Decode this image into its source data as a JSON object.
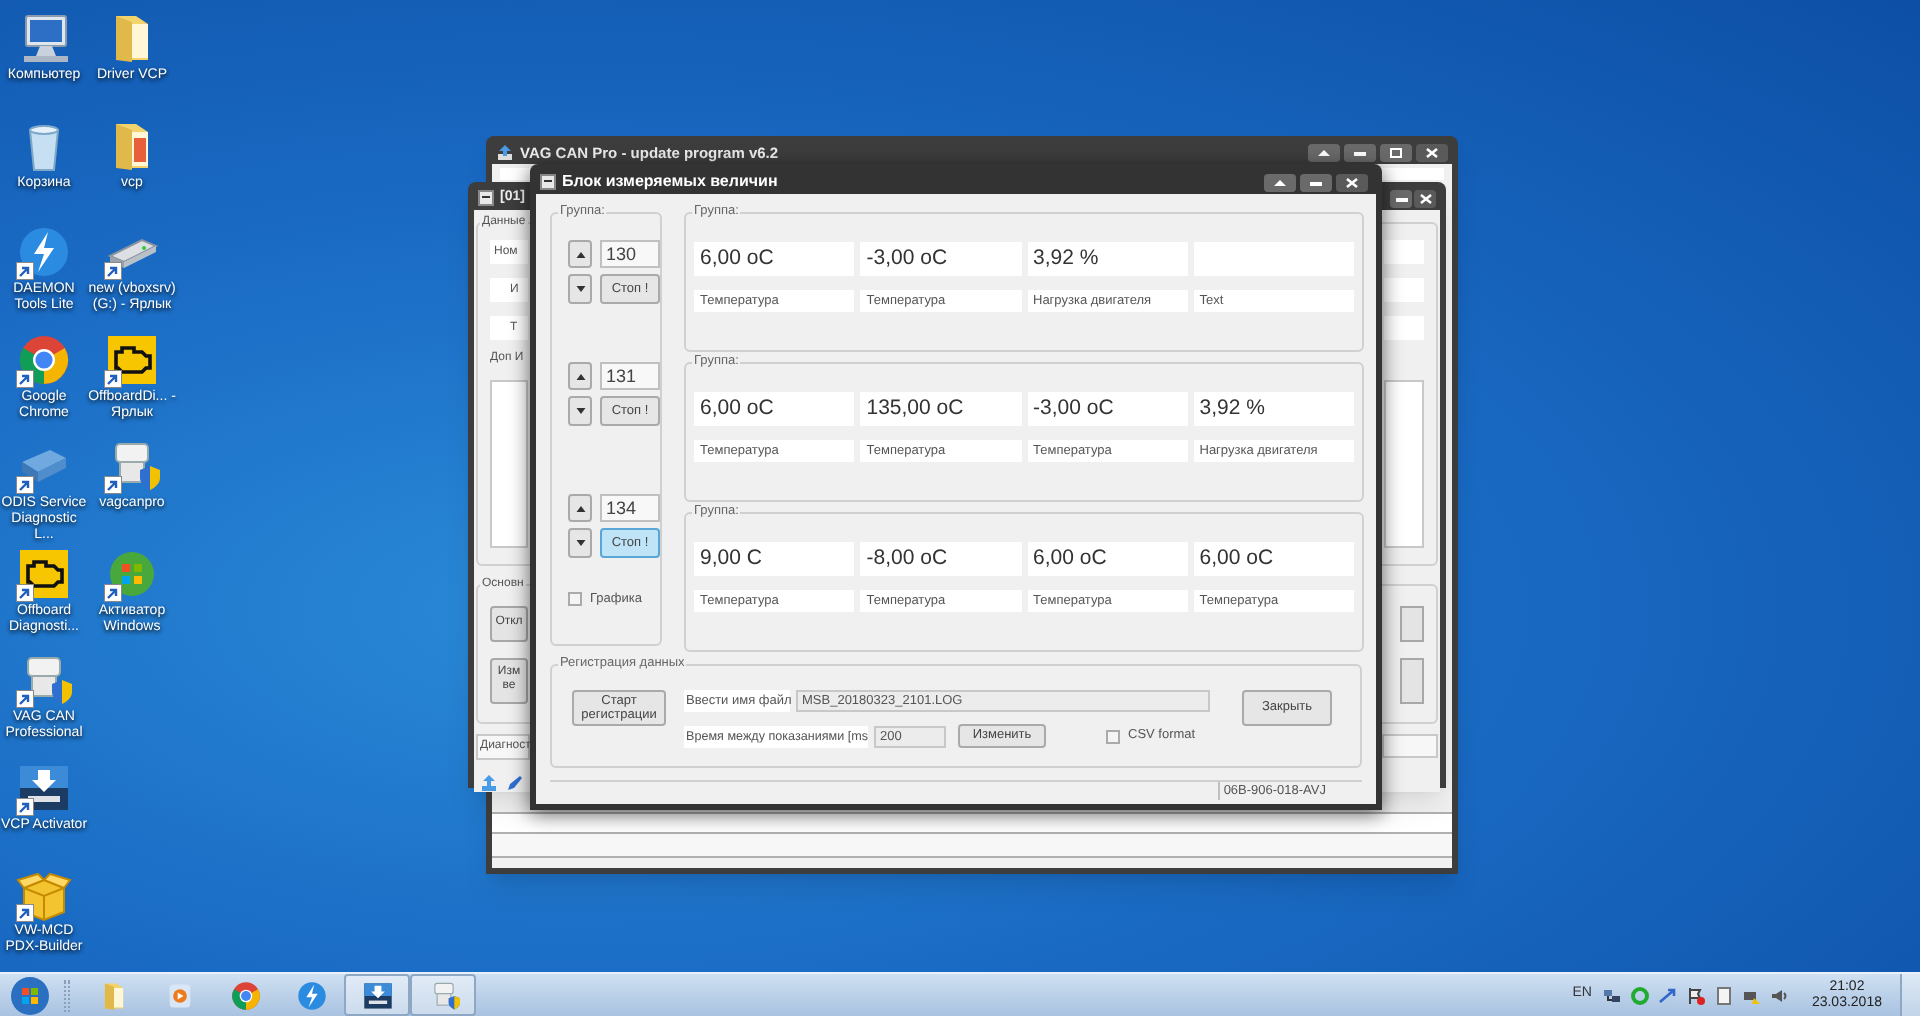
{
  "desktop_icons": [
    {
      "label": "Компьютер",
      "kind": "computer",
      "shortcut": false
    },
    {
      "label": "Корзина",
      "kind": "trash",
      "shortcut": false
    },
    {
      "label": "DAEMON Tools Lite",
      "kind": "lightning",
      "shortcut": true
    },
    {
      "label": "Google Chrome",
      "kind": "chrome",
      "shortcut": true
    },
    {
      "label": "ODIS Service Diagnostic L...",
      "kind": "device",
      "shortcut": true
    },
    {
      "label": "Offboard Diagnosti...",
      "kind": "engine",
      "shortcut": true
    },
    {
      "label": "VAG CAN Professional",
      "kind": "connector",
      "shortcut": true
    },
    {
      "label": "VCP Activator",
      "kind": "download",
      "shortcut": true
    },
    {
      "label": "VW-MCD PDX-Builder",
      "kind": "box",
      "shortcut": true
    },
    {
      "label": "Driver VCP",
      "kind": "folder",
      "shortcut": false
    },
    {
      "label": "vcp",
      "kind": "folder_doc",
      "shortcut": false
    },
    {
      "label": "new (vboxsrv) (G:) - Ярлык",
      "kind": "drive",
      "shortcut": true
    },
    {
      "label": "OffboardDi... - Ярлык",
      "kind": "engine",
      "shortcut": true
    },
    {
      "label": "vagcanpro",
      "kind": "connector",
      "shortcut": true
    },
    {
      "label": "Активатор Windows",
      "kind": "orb",
      "shortcut": true
    }
  ],
  "update_window": {
    "title": "VAG CAN Pro - update program v6.2"
  },
  "control_unit_window": {
    "title": "[01]",
    "data_group": "Данные",
    "fields": [
      "Ном",
      "И",
      "Т"
    ],
    "extra_label": "Доп И",
    "main_group": "Основн",
    "buttons": [
      "Откл",
      "Изм ве"
    ],
    "diag_label": "Диагност"
  },
  "measuring_window": {
    "title": "Блок измеряемых величин",
    "selector_title": "Группа:",
    "selectors": [
      {
        "number": "130",
        "stop_button": "Стоп !",
        "highlighted": false
      },
      {
        "number": "131",
        "stop_button": "Стоп !",
        "highlighted": false
      },
      {
        "number": "134",
        "stop_button": "Стоп !",
        "highlighted": true
      }
    ],
    "graph_checkbox": {
      "label": "Графика",
      "checked": false
    },
    "groups": [
      {
        "title": "Группа:",
        "cells": [
          {
            "value": "6,00 oC",
            "label": "Температура"
          },
          {
            "value": "-3,00 oC",
            "label": "Температура"
          },
          {
            "value": "3,92 %",
            "label": "Нагрузка двигателя"
          },
          {
            "label": "Text"
          }
        ]
      },
      {
        "title": "Группа:",
        "cells": [
          {
            "value": "6,00 oC",
            "label": "Температура"
          },
          {
            "value": "135,00 oC",
            "label": "Температура"
          },
          {
            "value": "-3,00 oC",
            "label": "Температура"
          },
          {
            "value": "3,92 %",
            "label": "Нагрузка двигателя"
          }
        ]
      },
      {
        "title": "Группа:",
        "cells": [
          {
            "value": "9,00 C",
            "label": "Температура"
          },
          {
            "value": "-8,00 oC",
            "label": "Температура"
          },
          {
            "value": "6,00 oC",
            "label": "Температура"
          },
          {
            "value": "6,00 oC",
            "label": "Температура"
          }
        ]
      }
    ],
    "logging": {
      "title": "Регистрация данных",
      "start_button": "Старт регистрации",
      "filename_label": "Ввести имя файл",
      "filename_value": "MSB_20180323_2101.LOG",
      "interval_label": "Время между показаниями [ms",
      "interval_value": "200",
      "change_button": "Изменить",
      "csv_checkbox": {
        "label": "CSV format",
        "checked": false
      },
      "close_button": "Закрыть"
    },
    "status": "06B-906-018-AVJ"
  },
  "taskbar": {
    "pinned": [
      {
        "kind": "folder",
        "active": false
      },
      {
        "kind": "media",
        "active": false
      },
      {
        "kind": "chrome",
        "active": false
      },
      {
        "kind": "lightning",
        "active": false
      },
      {
        "kind": "download",
        "active": true
      },
      {
        "kind": "connector",
        "active": true
      }
    ],
    "language": "EN",
    "time": "21:02",
    "date": "23.03.2018"
  }
}
